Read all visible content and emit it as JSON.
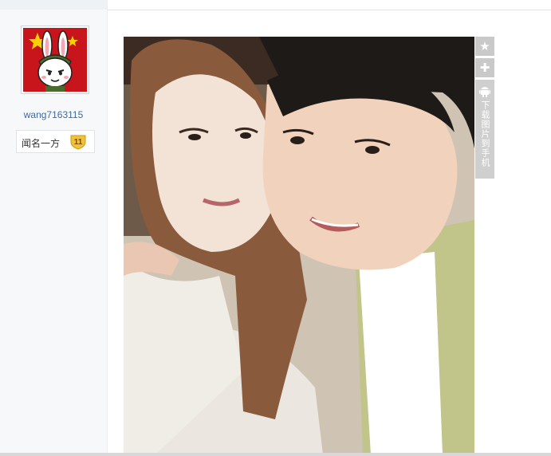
{
  "user": {
    "username": "wang7163115",
    "rank_title": "闻名一方",
    "level": "11"
  },
  "photo_tools": {
    "favorite_icon": "star-icon",
    "add_icon": "plus-icon",
    "android_icon": "android-icon",
    "download_label": "下载图片到手机"
  },
  "colors": {
    "username": "#3a6aa8",
    "badge": "#f0c23a",
    "tool_button": "#c9c9c9"
  }
}
